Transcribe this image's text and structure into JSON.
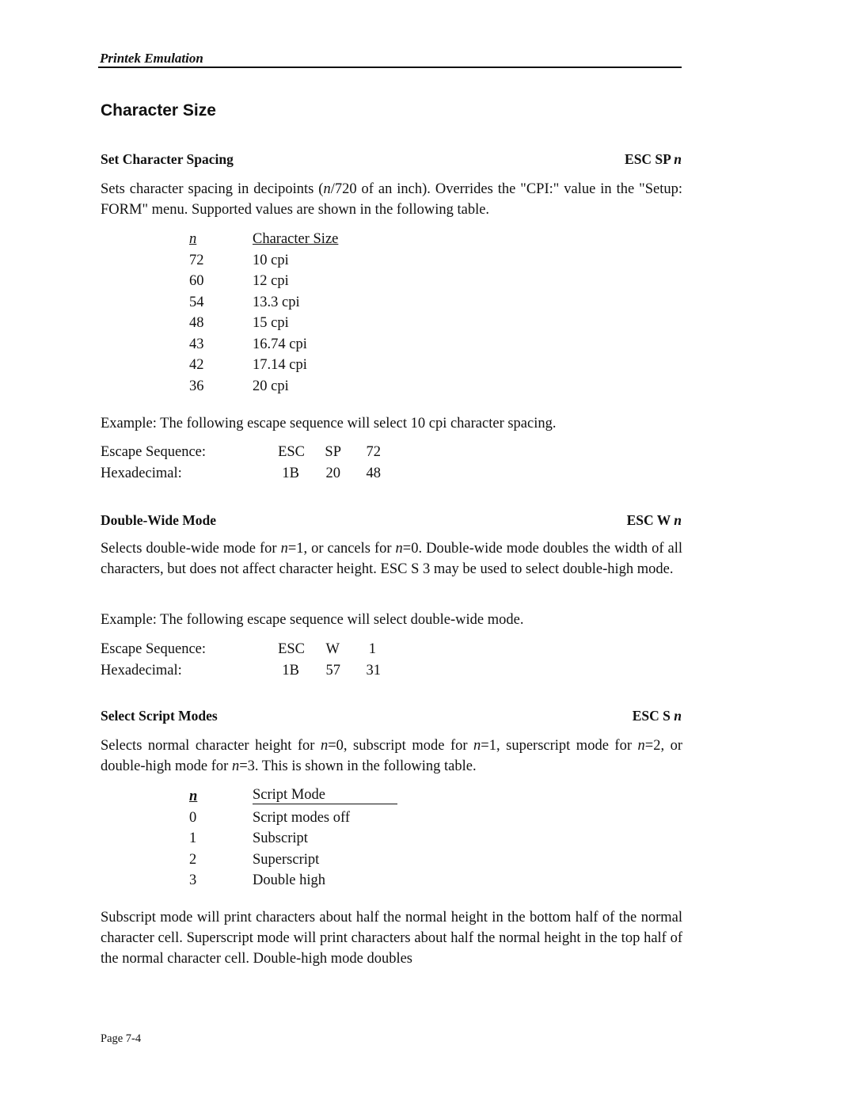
{
  "header": {
    "title": "Printek Emulation"
  },
  "section_title": "Character Size",
  "sections": [
    {
      "heading": "Set Character Spacing",
      "code_prefix": "ESC SP ",
      "code_param": "n",
      "description": [
        {
          "t": "Sets character spacing in decipoints ("
        },
        {
          "t": "n",
          "i": true
        },
        {
          "t": "/720 of an inch).  Overrides the \"CPI:\" value in the \"Setup: FORM\" menu.  Supported values are shown in the following table."
        }
      ],
      "table": {
        "headers": [
          "n",
          "Character Size"
        ],
        "rows": [
          [
            "72",
            "10 cpi"
          ],
          [
            "60",
            "12 cpi"
          ],
          [
            "54",
            "13.3 cpi"
          ],
          [
            "48",
            "15 cpi"
          ],
          [
            "43",
            "16.74 cpi"
          ],
          [
            "42",
            "17.14 cpi"
          ],
          [
            "36",
            "20 cpi"
          ]
        ]
      },
      "example": "Example:  The following escape sequence will select 10 cpi character spacing.",
      "sequence": {
        "escape_label": "Escape Sequence:",
        "escape_values": [
          "ESC",
          "SP",
          "72"
        ],
        "hex_label": "Hexadecimal:",
        "hex_values": [
          "1B",
          "20",
          "48"
        ]
      }
    },
    {
      "heading": "Double-Wide Mode",
      "code_prefix": "ESC W ",
      "code_param": "n",
      "description": [
        {
          "t": "Selects double-wide mode for "
        },
        {
          "t": "n",
          "i": true
        },
        {
          "t": "=1, or cancels for "
        },
        {
          "t": "n",
          "i": true
        },
        {
          "t": "=0.  Double-wide mode doubles the width of all characters, but does not affect character height.  ESC S 3 may be used to select double-high mode."
        }
      ],
      "example": "Example:  The following escape sequence will select double-wide mode.",
      "sequence": {
        "escape_label": "Escape Sequence:",
        "escape_values": [
          "ESC",
          "W",
          "1"
        ],
        "hex_label": "Hexadecimal:",
        "hex_values": [
          "1B",
          "57",
          "31"
        ]
      }
    },
    {
      "heading": "Select Script Modes",
      "code_prefix": "ESC S ",
      "code_param": "n",
      "description": [
        {
          "t": "Selects normal character height for "
        },
        {
          "t": "n",
          "i": true
        },
        {
          "t": "=0, subscript mode for "
        },
        {
          "t": "n",
          "i": true
        },
        {
          "t": "=1, superscript mode for "
        },
        {
          "t": "n",
          "i": true
        },
        {
          "t": "=2, or double-high mode for "
        },
        {
          "t": "n",
          "i": true
        },
        {
          "t": "=3.  This is shown in the following table."
        }
      ],
      "table": {
        "headers": [
          "n",
          "Script Mode"
        ],
        "rows": [
          [
            "0",
            "Script modes off"
          ],
          [
            "1",
            "Subscript"
          ],
          [
            "2",
            "Superscript"
          ],
          [
            "3",
            "Double high"
          ]
        ]
      },
      "closing": "Subscript mode will print characters about half the normal height in the bottom half of the normal character cell.  Superscript mode will print characters about half the normal height in the top half of the normal character cell.  Double-high mode doubles"
    }
  ],
  "footer": {
    "page": "Page 7-4"
  }
}
